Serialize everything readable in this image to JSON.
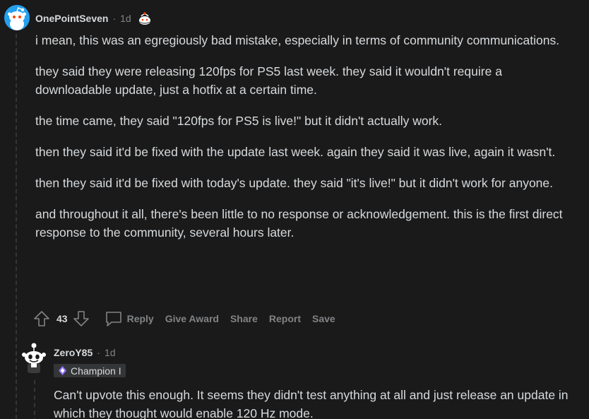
{
  "comment": {
    "username": "OnePointSeven",
    "separator": "·",
    "timestamp": "1d",
    "paragraphs": [
      "i mean, this was an egregiously bad mistake, especially in terms of community communications.",
      "they said they were releasing 120fps for PS5 last week. they said it wouldn't require a downloadable update, just a hotfix at a certain time.",
      "the time came, they said \"120fps for PS5 is live!\" but it didn't actually work.",
      "then they said it'd be fixed with the update last week. again they said it was live, again it wasn't.",
      "then they said it'd be fixed with today's update. they said \"it's live!\" but it didn't work for anyone.",
      "and throughout it all, there's been little to no response or acknowledgement. this is the first direct response to the community, several hours later."
    ],
    "votes": "43",
    "actions": {
      "reply": "Reply",
      "give_award": "Give Award",
      "share": "Share",
      "report": "Report",
      "save": "Save"
    },
    "icons": [
      "upvote-icon",
      "downvote-icon",
      "reply-bubble-icon",
      "cake-day-icon"
    ]
  },
  "reply": {
    "username": "ZeroY85",
    "separator": "·",
    "timestamp": "1d",
    "flair": "Champion I",
    "paragraphs": [
      "Can't upvote this enough. It seems they didn't test anything at all and just release an update in which they thought would enable 120 Hz mode."
    ]
  },
  "colors": {
    "background": "#1a1a1b",
    "text": "#d7dadc",
    "muted": "#818384",
    "avatar_blue": "#24a0ed",
    "flair_bg": "#343536",
    "champion_purple": "#8c6cff"
  }
}
